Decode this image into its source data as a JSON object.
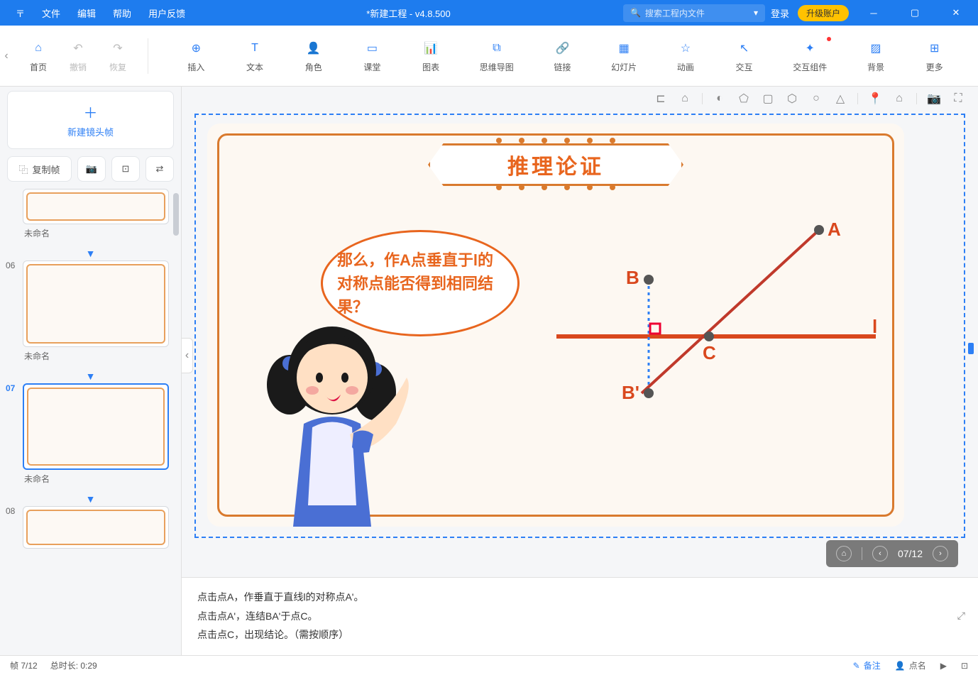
{
  "titlebar": {
    "menus": [
      "文件",
      "编辑",
      "帮助",
      "用户反馈"
    ],
    "title": "*新建工程 - v4.8.500",
    "search_placeholder": "搜索工程内文件",
    "login": "登录",
    "upgrade": "升级账户"
  },
  "toolbar": {
    "left": [
      {
        "label": "首页",
        "icon": "home"
      },
      {
        "label": "撤销",
        "icon": "undo"
      },
      {
        "label": "恢复",
        "icon": "redo"
      }
    ],
    "main": [
      {
        "label": "插入",
        "icon": "plus-circle"
      },
      {
        "label": "文本",
        "icon": "text"
      },
      {
        "label": "角色",
        "icon": "person"
      },
      {
        "label": "课堂",
        "icon": "board"
      },
      {
        "label": "图表",
        "icon": "chart"
      },
      {
        "label": "思维导图",
        "icon": "mindmap"
      },
      {
        "label": "链接",
        "icon": "link"
      },
      {
        "label": "幻灯片",
        "icon": "slides"
      },
      {
        "label": "动画",
        "icon": "star"
      },
      {
        "label": "交互",
        "icon": "cursor"
      },
      {
        "label": "交互组件",
        "icon": "widget"
      },
      {
        "label": "背景",
        "icon": "background"
      },
      {
        "label": "更多",
        "icon": "more"
      }
    ]
  },
  "sidebar": {
    "newframe": "新建镜头帧",
    "copyframe": "复制帧",
    "thumbs": [
      {
        "num": "",
        "name": "未命名"
      },
      {
        "num": "06",
        "name": "未命名"
      },
      {
        "num": "07",
        "name": "未命名",
        "active": true
      },
      {
        "num": "08",
        "name": ""
      }
    ]
  },
  "canvas": {
    "banner_title": "推理论证",
    "speech": "那么，作A点垂直于l的对称点能否得到相同结果？",
    "labels": {
      "A": "A",
      "B": "B",
      "Bp": "B'",
      "C": "C",
      "l": "l"
    }
  },
  "slidenav": {
    "counter": "07/12"
  },
  "notes": {
    "lines": [
      "点击点A，作垂直于直线l的对称点A'。",
      "点击点A'，连结BA'于点C。",
      "点击点C，出现结论。（需按顺序）"
    ]
  },
  "status": {
    "frame": "帧 7/12",
    "duration": "总时长: 0:29",
    "note_btn": "备注",
    "roll_btn": "点名"
  }
}
